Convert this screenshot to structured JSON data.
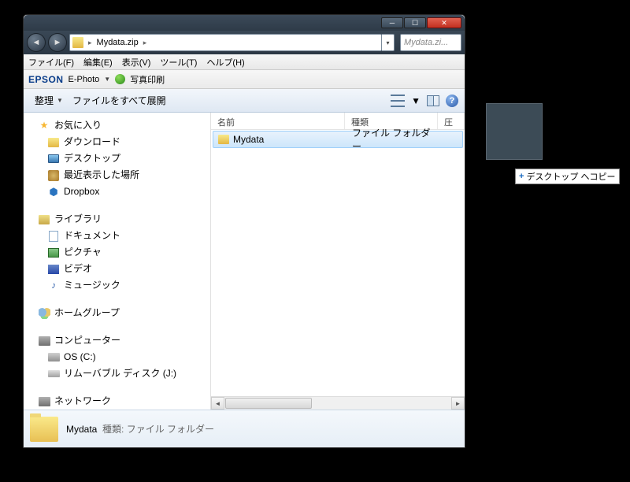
{
  "title": "Mydata.zip",
  "address": {
    "folder_icon": "folder",
    "path": "Mydata.zip",
    "arrow": "▸"
  },
  "search": {
    "placeholder": "Mydata.zi..."
  },
  "menu": {
    "file": "ファイル(F)",
    "edit": "編集(E)",
    "view": "表示(V)",
    "tools": "ツール(T)",
    "help": "ヘルプ(H)"
  },
  "epson": {
    "logo": "EPSON",
    "ephoto": "E-Photo",
    "print": "写真印刷"
  },
  "cmd": {
    "organize": "整理",
    "extract": "ファイルをすべて展開"
  },
  "sidebar": {
    "favorites": {
      "label": "お気に入り",
      "downloads": "ダウンロード",
      "desktop": "デスクトップ",
      "recent": "最近表示した場所",
      "dropbox": "Dropbox"
    },
    "libraries": {
      "label": "ライブラリ",
      "documents": "ドキュメント",
      "pictures": "ピクチャ",
      "videos": "ビデオ",
      "music": "ミュージック"
    },
    "homegroup": "ホームグループ",
    "computer": {
      "label": "コンピューター",
      "osc": "OS (C:)",
      "removable": "リムーバブル ディスク (J:)"
    },
    "network": "ネットワーク"
  },
  "columns": {
    "name": "名前",
    "type": "種類",
    "last": "圧"
  },
  "item": {
    "name": "Mydata",
    "type": "ファイル フォルダー"
  },
  "details": {
    "name": "Mydata",
    "type_label": "種類:",
    "type": "ファイル フォルダー"
  },
  "drag": {
    "tip": "デスクトップ へコピー"
  }
}
